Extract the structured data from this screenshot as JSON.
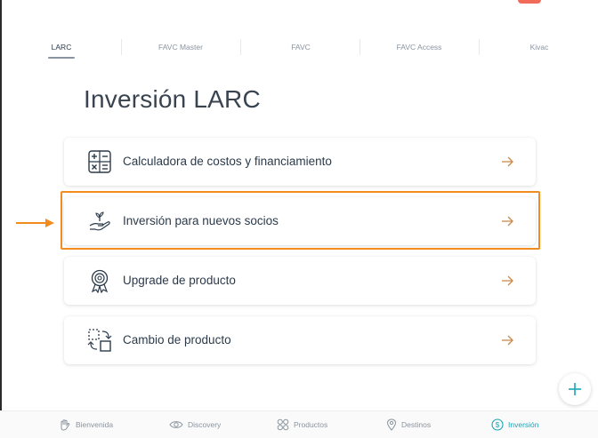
{
  "tabs": [
    {
      "label": "LARC",
      "active": true
    },
    {
      "label": "FAVC Master",
      "active": false
    },
    {
      "label": "FAVC",
      "active": false
    },
    {
      "label": "FAVC Access",
      "active": false
    },
    {
      "label": "Kivac",
      "active": false
    }
  ],
  "page": {
    "title": "Inversión LARC"
  },
  "menu": [
    {
      "label": "Calculadora de costos y financiamiento",
      "icon": "calculator-icon"
    },
    {
      "label": "Inversión para nuevos socios",
      "icon": "plant-in-hand-icon",
      "highlighted": true
    },
    {
      "label": "Upgrade de producto",
      "icon": "award-badge-icon"
    },
    {
      "label": "Cambio de producto",
      "icon": "swap-product-icon"
    }
  ],
  "bottom_nav": [
    {
      "label": "Bienvenida",
      "icon": "hand-icon"
    },
    {
      "label": "Discovery",
      "icon": "eye-icon"
    },
    {
      "label": "Productos",
      "icon": "grid-icon"
    },
    {
      "label": "Destinos",
      "icon": "location-pin-icon"
    },
    {
      "label": "Inversión",
      "icon": "dollar-coin-icon",
      "active": true
    }
  ],
  "colors": {
    "highlight": "#f28c1e",
    "accent": "#1aa6b7",
    "arrow": "#c98a4a",
    "text": "#2b3a4a",
    "muted": "#8a949e"
  }
}
